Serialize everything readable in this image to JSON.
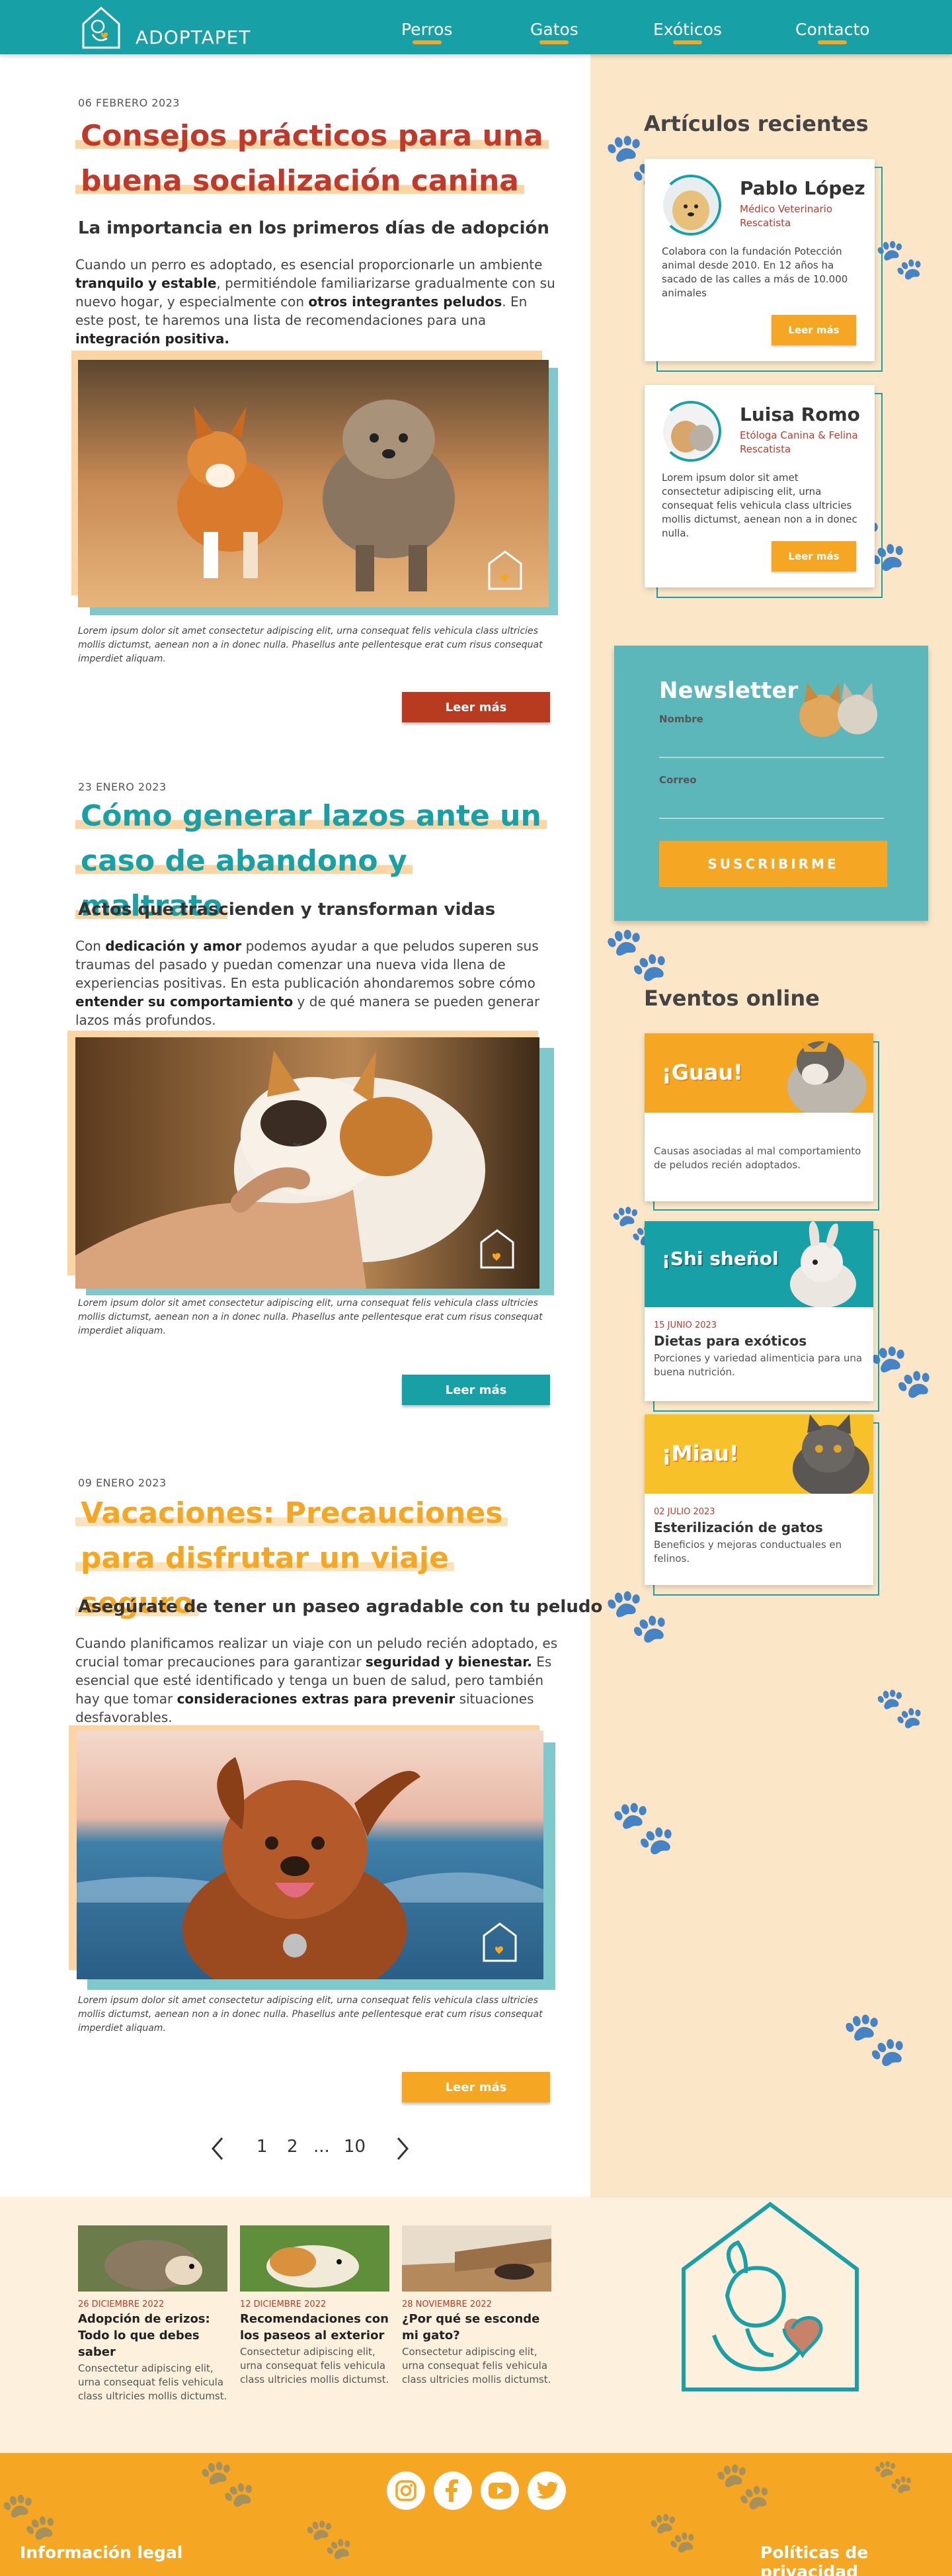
{
  "header": {
    "brand": "ADOPTAPET",
    "nav": [
      "Perros",
      "Gatos",
      "Exóticos",
      "Contacto"
    ]
  },
  "articles": [
    {
      "date": "06 FEBRERO 2023",
      "title": "Consejos prácticos para una buena socialización canina",
      "subtitle": "La importancia en los primeros días de adopción",
      "body_parts": [
        "Cuando un perro es adoptado, es esencial proporcionarle un ambiente ",
        "tranquilo y estable",
        ", permitiéndole familiarizarse gradualmente con su nuevo hogar, y especialmente con ",
        "otros integrantes peludos",
        ". En este post, te haremos una lista de recomendaciones para una ",
        "integración positiva."
      ],
      "caption": "Lorem ipsum dolor sit amet consectetur adipiscing elit, urna consequat felis vehicula class ultricies mollis dictumst, aenean non a in donec nulla. Phasellus ante pellentesque erat cum risus consequat imperdiet aliquam.",
      "button": "Leer más"
    },
    {
      "date": "23 ENERO 2023",
      "title": "Cómo generar lazos ante un caso de abandono y maltrato",
      "subtitle": "Actos que trascienden y transforman vidas",
      "body_parts": [
        "Con ",
        "dedicación y amor",
        " podemos ayudar a que peludos superen sus traumas del pasado y puedan comenzar una nueva vida llena de experiencias positivas. En esta publicación ahondaremos sobre cómo ",
        "entender su comportamiento",
        " y de qué manera se pueden generar lazos más profundos."
      ],
      "caption": "Lorem ipsum dolor sit amet consectetur adipiscing elit, urna consequat felis vehicula class ultricies mollis dictumst, aenean non a in donec nulla. Phasellus ante pellentesque erat cum risus consequat imperdiet aliquam.",
      "button": "Leer más"
    },
    {
      "date": "09 ENERO 2023",
      "title": "Vacaciones: Precauciones para disfrutar un viaje seguro",
      "subtitle": "Asegúrate de tener un paseo agradable con tu peludo",
      "body_parts": [
        "Cuando planificamos realizar un viaje con un peludo recién adoptado, es crucial tomar precauciones para garantizar ",
        "seguridad y bienestar.",
        " Es esencial que esté identificado y tenga un buen de salud, pero también hay que tomar ",
        "consideraciones extras para prevenir",
        " situaciones desfavorables."
      ],
      "caption": "Lorem ipsum dolor sit amet consectetur adipiscing elit, urna consequat felis vehicula class ultricies mollis dictumst, aenean non a in donec nulla. Phasellus ante pellentesque erat cum risus consequat imperdiet aliquam.",
      "button": "Leer más"
    }
  ],
  "pagination": {
    "pages": [
      "1",
      "2",
      "...",
      "10"
    ],
    "current": "1",
    "prev_icon": "chevron-left-icon",
    "next_icon": "chevron-right-icon"
  },
  "related": [
    {
      "date": "26 DICIEMBRE 2022",
      "title": "Adopción de erizos: Todo lo que debes saber",
      "text": "Consectetur adipiscing elit, urna consequat felis vehicula class ultricies mollis dictumst."
    },
    {
      "date": "12 DICIEMBRE 2022",
      "title": "Recomendaciones con los paseos al exterior",
      "text": "Consectetur adipiscing elit, urna consequat felis vehicula class ultricies mollis dictumst."
    },
    {
      "date": "28 NOVIEMBRE 2022",
      "title": "¿Por qué se esconde mi gato?",
      "text": "Consectetur adipiscing elit, urna consequat felis vehicula class ultricies mollis dictumst."
    }
  ],
  "sidebar": {
    "recent_heading": "Artículos recientes",
    "authors": [
      {
        "name": "Pablo López",
        "role": "Médico Veterinario Rescatista",
        "bio": "Colabora con la fundación Potección animal desde 2010. En 12 años ha  sacado de las calles a más de 10.000 animales",
        "button": "Leer más"
      },
      {
        "name": "Luisa Romo",
        "role": "Etóloga Canina & Felina Rescatista",
        "bio": "Lorem ipsum dolor sit amet consectetur adipiscing elit, urna consequat felis vehicula class ultricies mollis dictumst, aenean non a in donec nulla.",
        "button": "Leer más"
      }
    ],
    "newsletter": {
      "title": "Newsletter",
      "name_label": "Nombre",
      "email_label": "Correo",
      "button": "SUSCRIBIRME"
    },
    "events_heading": "Eventos online",
    "events": [
      {
        "banner": "¡Guau!",
        "date": "",
        "title": "",
        "text": "Causas asociadas al mal comportamiento de peludos recién adoptados."
      },
      {
        "banner": "¡Shi sheñol",
        "date": "15 JUNIO 2023",
        "title": "Dietas para exóticos",
        "text": "Porciones y variedad alimenticia para una buena nutrición."
      },
      {
        "banner": "¡Miau!",
        "date": "02 JULIO 2023",
        "title": "Esterilización de gatos",
        "text": "Beneficios y mejoras conductuales en felinos."
      }
    ]
  },
  "footer": {
    "social": [
      "instagram-icon",
      "facebook-icon",
      "youtube-icon",
      "twitter-icon"
    ],
    "legal": "Información legal",
    "privacy": "Políticas de privacidad"
  },
  "colors": {
    "teal": "#17a0a6",
    "orange": "#f5a623",
    "red": "#c0392b",
    "cream": "#fbe7c8"
  }
}
